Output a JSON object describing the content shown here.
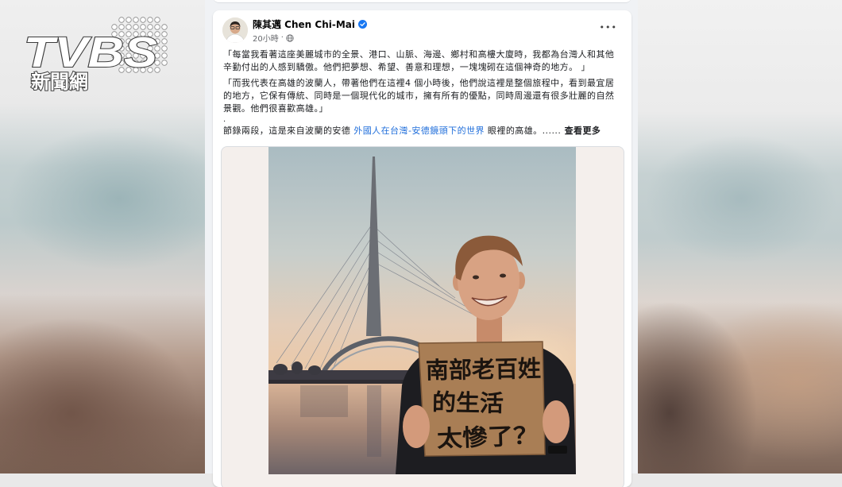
{
  "logo": {
    "brand": "TVBS",
    "subtitle": "新聞網"
  },
  "post": {
    "author": "陳其邁 Chen Chi-Mai",
    "time": "20小時",
    "separator": "·",
    "more": "•••",
    "p1": [
      "「每當我看著這座美麗城市的全景、港口、山脈、海邊、鄉村和高樓大廈時，我都為台灣人和其他",
      "辛勤付出的人感到驕傲。他們把夢想、希望、善意和理想，一塊塊砌在這個神奇的地方。 」"
    ],
    "p2": [
      "「而我代表在高雄的波蘭人，帶著他們在這裡4 個小時後，他們說這裡是整個旅程中，看到最宜居",
      "的地方，它保有傳統、同時是一個現代化的城市，擁有所有的優點，同時周邊還有很多壯麗的自然",
      "景觀。他們很喜歡高雄。」"
    ],
    "dot": ".",
    "excerpt": {
      "before": "節錄兩段，這是來自波蘭的安德 ",
      "link": "外國人在台灣-安德鏡頭下的世界",
      "after": " 眼裡的高雄。......",
      "see_more": " 查看更多"
    }
  },
  "photo": {
    "sign_lines": [
      "南部老百姓",
      "的生活",
      "太慘了？"
    ]
  },
  "icons": {
    "verified": "verified-badge-icon",
    "privacy": "globe-icon",
    "menu": "more-options-icon"
  },
  "colors": {
    "verified": "#1877f2",
    "link": "#216fdb",
    "feed_bg": "#f0f2f5"
  }
}
